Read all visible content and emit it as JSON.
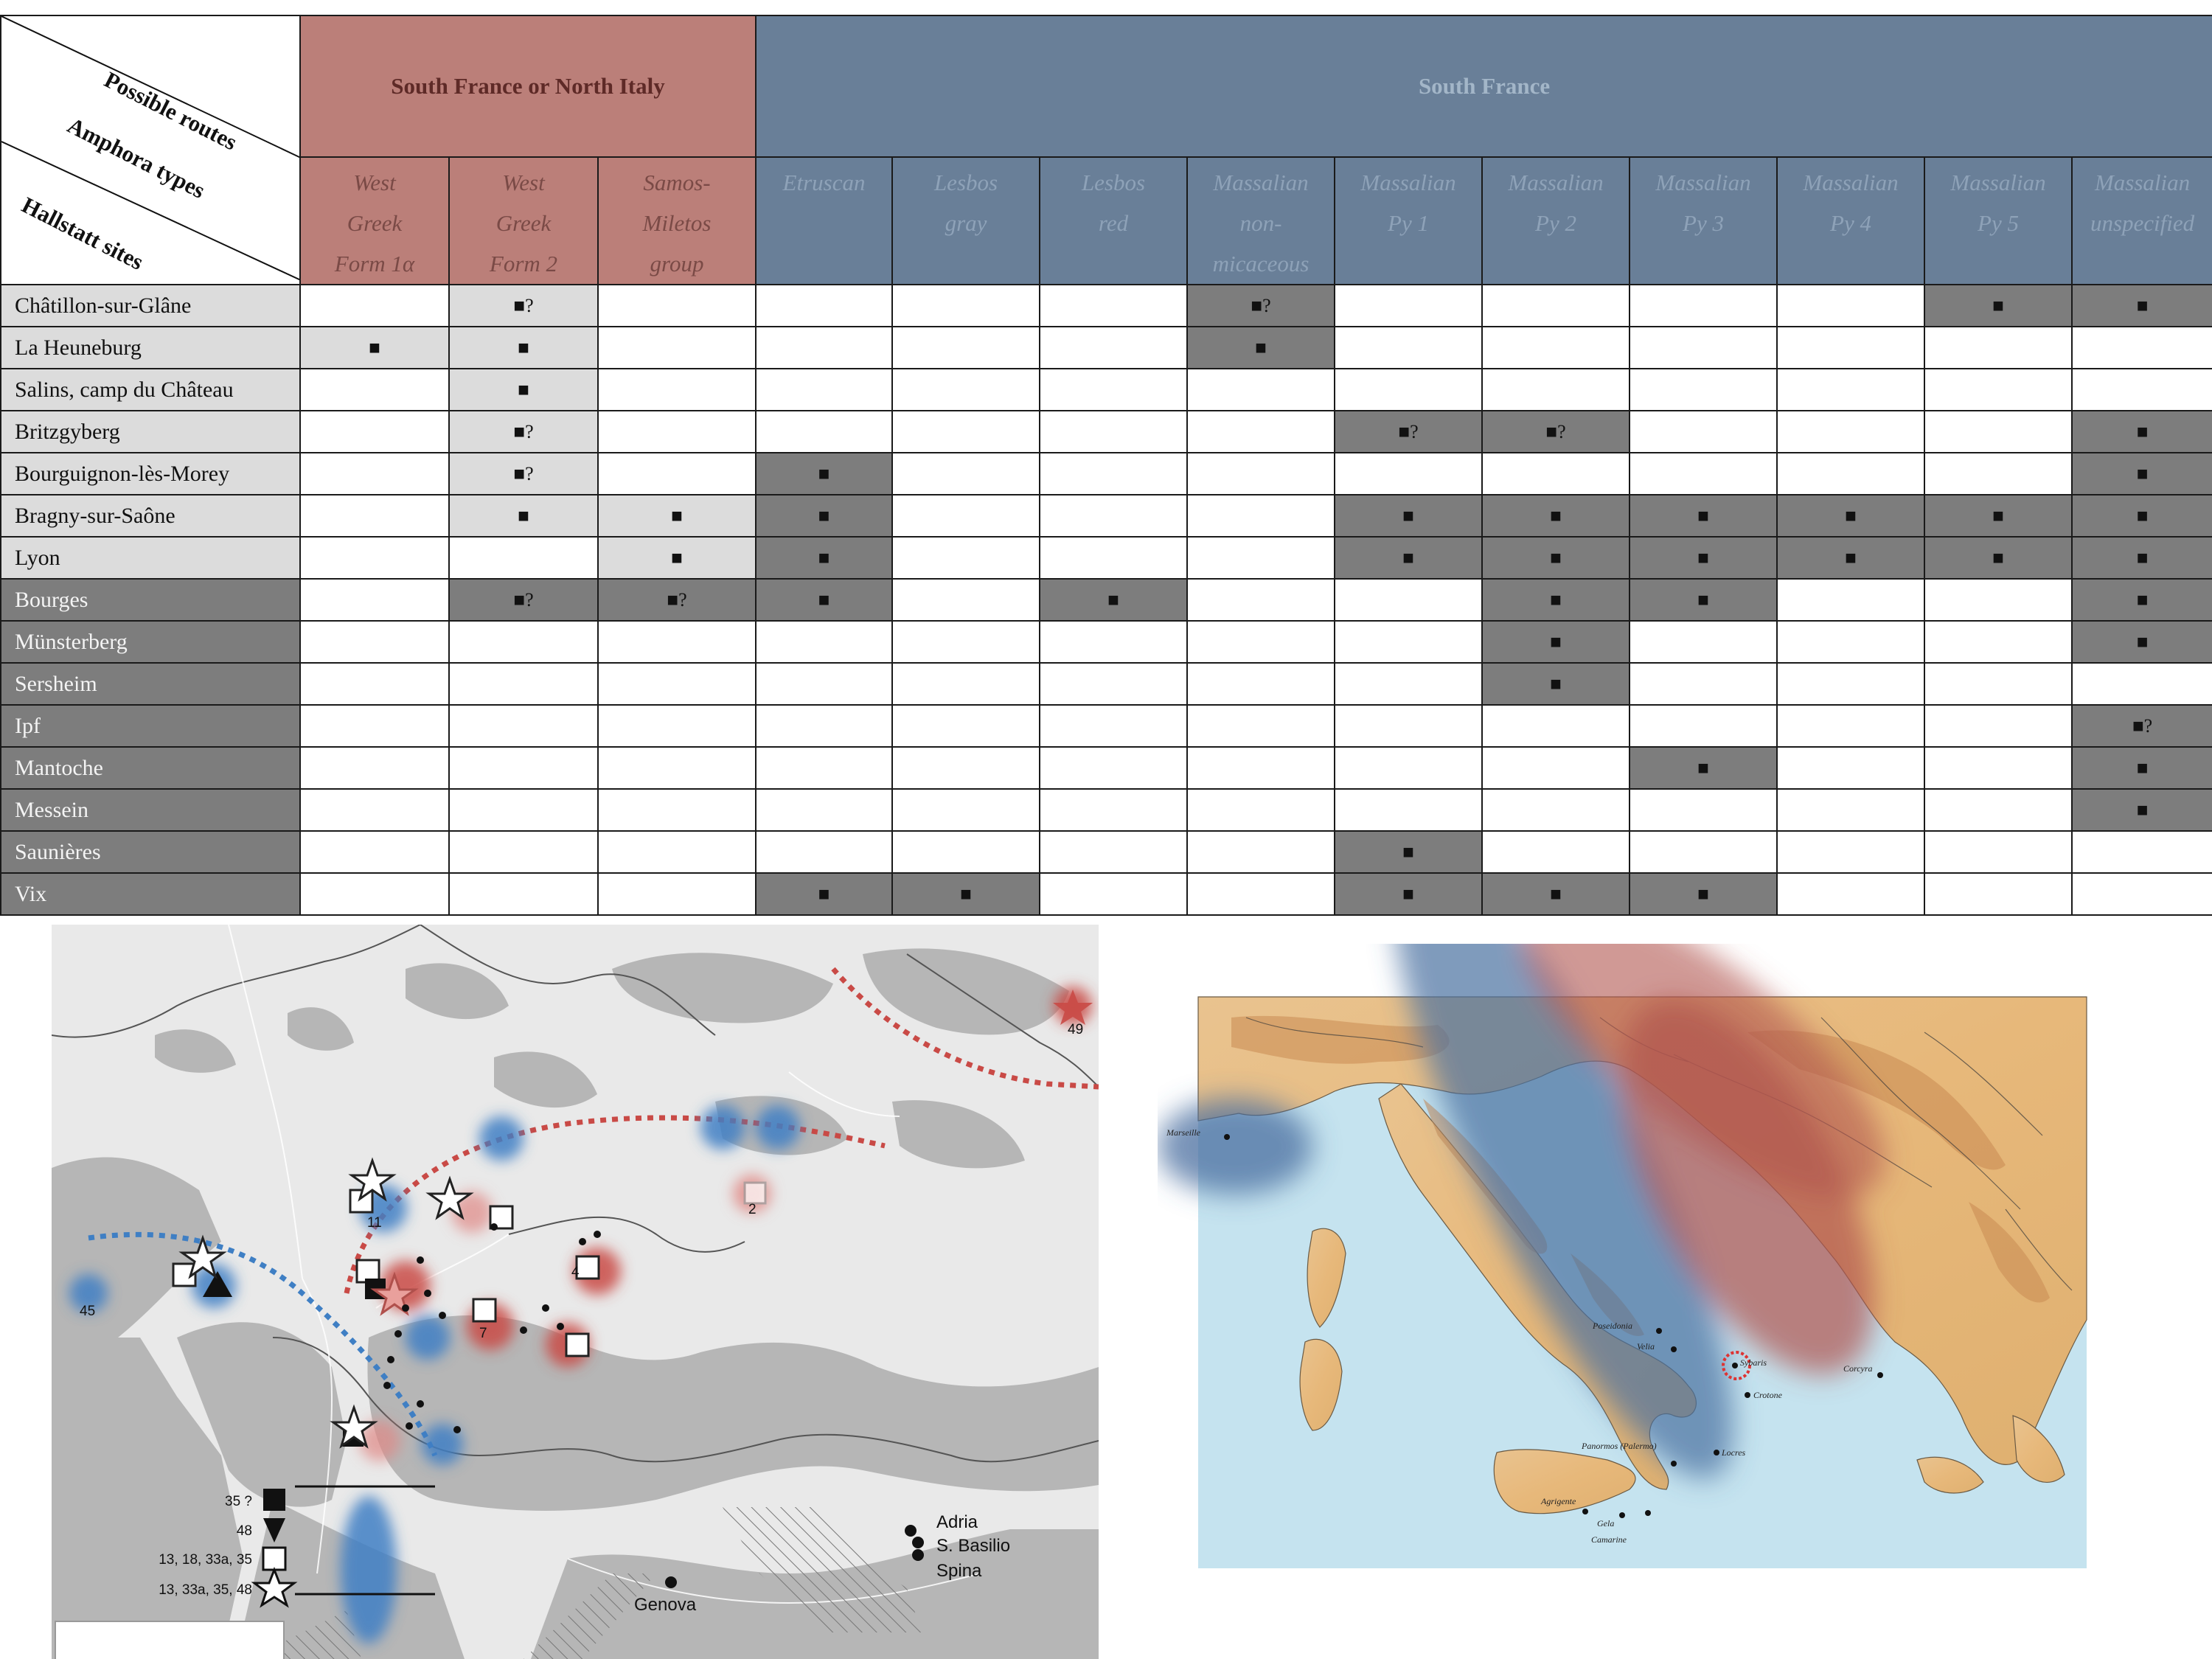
{
  "table": {
    "corner": {
      "routes_label": "Possible routes",
      "types_label": "Amphora types",
      "sites_label": "Hallstatt sites"
    },
    "routes": [
      {
        "label": "South France or North Italy",
        "color": "#bb7f79"
      },
      {
        "label": "South France",
        "color": "#697f98"
      }
    ],
    "amphora_types": [
      {
        "lines": [
          "West",
          "Greek",
          "Form 1α"
        ]
      },
      {
        "lines": [
          "West",
          "Greek",
          "Form 2"
        ]
      },
      {
        "lines": [
          "Samos-",
          "Miletos",
          "group"
        ]
      },
      {
        "lines": [
          "Etruscan",
          "",
          ""
        ]
      },
      {
        "lines": [
          "Lesbos",
          "gray",
          ""
        ]
      },
      {
        "lines": [
          "Lesbos",
          "red",
          ""
        ]
      },
      {
        "lines": [
          "Massalian",
          "non-",
          "micaceous"
        ]
      },
      {
        "lines": [
          "Massalian",
          "Py 1",
          ""
        ]
      },
      {
        "lines": [
          "Massalian",
          "Py 2",
          ""
        ]
      },
      {
        "lines": [
          "Massalian",
          "Py 3",
          ""
        ]
      },
      {
        "lines": [
          "Massalian",
          "Py 4",
          ""
        ]
      },
      {
        "lines": [
          "Massalian",
          "Py 5",
          ""
        ]
      },
      {
        "lines": [
          "Massalian",
          "unspecified",
          ""
        ]
      }
    ],
    "rows": [
      {
        "site": "Châtillon-sur-Glâne",
        "shade": "light",
        "cells": [
          [
            "",
            "w"
          ],
          [
            "■?",
            "l"
          ],
          [
            "",
            "w"
          ],
          [
            "",
            "w"
          ],
          [
            "",
            "w"
          ],
          [
            "",
            "w"
          ],
          [
            "■?",
            "d"
          ],
          [
            "",
            "w"
          ],
          [
            "",
            "w"
          ],
          [
            "",
            "w"
          ],
          [
            "",
            "w"
          ],
          [
            "■",
            "d"
          ],
          [
            "■",
            "d"
          ]
        ]
      },
      {
        "site": "La Heuneburg",
        "shade": "light",
        "cells": [
          [
            "■",
            "l"
          ],
          [
            "■",
            "l"
          ],
          [
            "",
            "w"
          ],
          [
            "",
            "w"
          ],
          [
            "",
            "w"
          ],
          [
            "",
            "w"
          ],
          [
            "■",
            "d"
          ],
          [
            "",
            "w"
          ],
          [
            "",
            "w"
          ],
          [
            "",
            "w"
          ],
          [
            "",
            "w"
          ],
          [
            "",
            "w"
          ],
          [
            "",
            "w"
          ]
        ]
      },
      {
        "site": "Salins, camp du Château",
        "shade": "light",
        "cells": [
          [
            "",
            "w"
          ],
          [
            "■",
            "l"
          ],
          [
            "",
            "w"
          ],
          [
            "",
            "w"
          ],
          [
            "",
            "w"
          ],
          [
            "",
            "w"
          ],
          [
            "",
            "w"
          ],
          [
            "",
            "w"
          ],
          [
            "",
            "w"
          ],
          [
            "",
            "w"
          ],
          [
            "",
            "w"
          ],
          [
            "",
            "w"
          ],
          [
            "",
            "w"
          ]
        ]
      },
      {
        "site": "Britzgyberg",
        "shade": "light",
        "cells": [
          [
            "",
            "w"
          ],
          [
            "■?",
            "l"
          ],
          [
            "",
            "w"
          ],
          [
            "",
            "w"
          ],
          [
            "",
            "w"
          ],
          [
            "",
            "w"
          ],
          [
            "",
            "w"
          ],
          [
            "■?",
            "d"
          ],
          [
            "■?",
            "d"
          ],
          [
            "",
            "w"
          ],
          [
            "",
            "w"
          ],
          [
            "",
            "w"
          ],
          [
            "■",
            "d"
          ]
        ]
      },
      {
        "site": "Bourguignon-lès-Morey",
        "shade": "light",
        "cells": [
          [
            "",
            "w"
          ],
          [
            "■?",
            "l"
          ],
          [
            "",
            "w"
          ],
          [
            "■",
            "d"
          ],
          [
            "",
            "w"
          ],
          [
            "",
            "w"
          ],
          [
            "",
            "w"
          ],
          [
            "",
            "w"
          ],
          [
            "",
            "w"
          ],
          [
            "",
            "w"
          ],
          [
            "",
            "w"
          ],
          [
            "",
            "w"
          ],
          [
            "■",
            "d"
          ]
        ]
      },
      {
        "site": "Bragny-sur-Saône",
        "shade": "light",
        "cells": [
          [
            "",
            "w"
          ],
          [
            "■",
            "l"
          ],
          [
            "■",
            "l"
          ],
          [
            "■",
            "d"
          ],
          [
            "",
            "w"
          ],
          [
            "",
            "w"
          ],
          [
            "",
            "w"
          ],
          [
            "■",
            "d"
          ],
          [
            "■",
            "d"
          ],
          [
            "■",
            "d"
          ],
          [
            "■",
            "d"
          ],
          [
            "■",
            "d"
          ],
          [
            "■",
            "d"
          ]
        ]
      },
      {
        "site": "Lyon",
        "shade": "light",
        "cells": [
          [
            "",
            "w"
          ],
          [
            "",
            "w"
          ],
          [
            "■",
            "l"
          ],
          [
            "■",
            "d"
          ],
          [
            "",
            "w"
          ],
          [
            "",
            "w"
          ],
          [
            "",
            "w"
          ],
          [
            "■",
            "d"
          ],
          [
            "■",
            "d"
          ],
          [
            "■",
            "d"
          ],
          [
            "■",
            "d"
          ],
          [
            "■",
            "d"
          ],
          [
            "■",
            "d"
          ]
        ]
      },
      {
        "site": "Bourges",
        "shade": "dark",
        "cells": [
          [
            "",
            "w"
          ],
          [
            "■?",
            "d"
          ],
          [
            "■?",
            "d"
          ],
          [
            "■",
            "d"
          ],
          [
            "",
            "w"
          ],
          [
            "■",
            "d"
          ],
          [
            "",
            "w"
          ],
          [
            "",
            "w"
          ],
          [
            "■",
            "d"
          ],
          [
            "■",
            "d"
          ],
          [
            "",
            "w"
          ],
          [
            "",
            "w"
          ],
          [
            "■",
            "d"
          ]
        ]
      },
      {
        "site": "Münsterberg",
        "shade": "dark",
        "cells": [
          [
            "",
            "w"
          ],
          [
            "",
            "w"
          ],
          [
            "",
            "w"
          ],
          [
            "",
            "w"
          ],
          [
            "",
            "w"
          ],
          [
            "",
            "w"
          ],
          [
            "",
            "w"
          ],
          [
            "",
            "w"
          ],
          [
            "■",
            "d"
          ],
          [
            "",
            "w"
          ],
          [
            "",
            "w"
          ],
          [
            "",
            "w"
          ],
          [
            "■",
            "d"
          ]
        ]
      },
      {
        "site": "Sersheim",
        "shade": "dark",
        "cells": [
          [
            "",
            "w"
          ],
          [
            "",
            "w"
          ],
          [
            "",
            "w"
          ],
          [
            "",
            "w"
          ],
          [
            "",
            "w"
          ],
          [
            "",
            "w"
          ],
          [
            "",
            "w"
          ],
          [
            "",
            "w"
          ],
          [
            "■",
            "d"
          ],
          [
            "",
            "w"
          ],
          [
            "",
            "w"
          ],
          [
            "",
            "w"
          ],
          [
            "",
            "w"
          ]
        ]
      },
      {
        "site": "Ipf",
        "shade": "dark",
        "cells": [
          [
            "",
            "w"
          ],
          [
            "",
            "w"
          ],
          [
            "",
            "w"
          ],
          [
            "",
            "w"
          ],
          [
            "",
            "w"
          ],
          [
            "",
            "w"
          ],
          [
            "",
            "w"
          ],
          [
            "",
            "w"
          ],
          [
            "",
            "w"
          ],
          [
            "",
            "w"
          ],
          [
            "",
            "w"
          ],
          [
            "",
            "w"
          ],
          [
            "■?",
            "d"
          ]
        ]
      },
      {
        "site": "Mantoche",
        "shade": "dark",
        "cells": [
          [
            "",
            "w"
          ],
          [
            "",
            "w"
          ],
          [
            "",
            "w"
          ],
          [
            "",
            "w"
          ],
          [
            "",
            "w"
          ],
          [
            "",
            "w"
          ],
          [
            "",
            "w"
          ],
          [
            "",
            "w"
          ],
          [
            "",
            "w"
          ],
          [
            "■",
            "d"
          ],
          [
            "",
            "w"
          ],
          [
            "",
            "w"
          ],
          [
            "■",
            "d"
          ]
        ]
      },
      {
        "site": "Messein",
        "shade": "dark",
        "cells": [
          [
            "",
            "w"
          ],
          [
            "",
            "w"
          ],
          [
            "",
            "w"
          ],
          [
            "",
            "w"
          ],
          [
            "",
            "w"
          ],
          [
            "",
            "w"
          ],
          [
            "",
            "w"
          ],
          [
            "",
            "w"
          ],
          [
            "",
            "w"
          ],
          [
            "",
            "w"
          ],
          [
            "",
            "w"
          ],
          [
            "",
            "w"
          ],
          [
            "■",
            "d"
          ]
        ]
      },
      {
        "site": "Saunières",
        "shade": "dark",
        "cells": [
          [
            "",
            "w"
          ],
          [
            "",
            "w"
          ],
          [
            "",
            "w"
          ],
          [
            "",
            "w"
          ],
          [
            "",
            "w"
          ],
          [
            "",
            "w"
          ],
          [
            "",
            "w"
          ],
          [
            "■",
            "d"
          ],
          [
            "",
            "w"
          ],
          [
            "",
            "w"
          ],
          [
            "",
            "w"
          ],
          [
            "",
            "w"
          ],
          [
            "",
            "w"
          ]
        ]
      },
      {
        "site": "Vix",
        "shade": "dark",
        "cells": [
          [
            "",
            "w"
          ],
          [
            "",
            "w"
          ],
          [
            "",
            "w"
          ],
          [
            "■",
            "d"
          ],
          [
            "■",
            "d"
          ],
          [
            "",
            "w"
          ],
          [
            "",
            "w"
          ],
          [
            "■",
            "d"
          ],
          [
            "■",
            "d"
          ],
          [
            "■",
            "d"
          ],
          [
            "",
            "w"
          ],
          [
            "",
            "w"
          ],
          [
            "",
            "w"
          ]
        ]
      }
    ]
  },
  "map_left": {
    "site_numbers": [
      "49",
      "11",
      "2",
      "4",
      "7",
      "45"
    ],
    "legend": [
      {
        "label": "35 ?",
        "symbol": "filled-square"
      },
      {
        "label": "48",
        "symbol": "filled-triangle"
      },
      {
        "label": "13, 18, 33a, 35",
        "symbol": "open-square"
      },
      {
        "label": "13, 33a, 35, 48",
        "symbol": "open-star"
      }
    ],
    "cities": [
      "Adria",
      "S. Basilio",
      "Spina",
      "Genova"
    ],
    "colors": {
      "north_italy_route": "#c94a46",
      "south_france_route": "#3f7fc4",
      "land": "#b4b4b4"
    }
  },
  "map_right": {
    "places": [
      "Marseille",
      "Poseidonia",
      "Velia",
      "Sybaris",
      "Crotone",
      "Corcyra",
      "Panormos (Palermo)",
      "Locres",
      "Agrigente",
      "Gela",
      "Camarine"
    ],
    "colors": {
      "sea": "#c5e3ef",
      "north_route": "#b0564f",
      "west_route": "#4a6fa0"
    }
  }
}
